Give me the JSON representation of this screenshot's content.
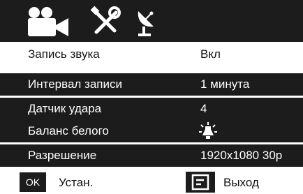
{
  "top_icons": [
    {
      "icon": "video-camera-icon"
    },
    {
      "icon": "tools-icon"
    },
    {
      "icon": "satellite-dish-icon"
    }
  ],
  "menu": {
    "items": [
      {
        "label": "Запись звука",
        "value": "Вкл",
        "selected": true
      },
      {
        "label": "Интервал записи",
        "value": "1 минута",
        "selected": false
      },
      {
        "label": "Датчик удара",
        "value": "4",
        "selected": false
      },
      {
        "label": "Баланс белого",
        "value_icon": "lightbulb-icon",
        "selected": false
      },
      {
        "label": "Разрешение",
        "value": "1920x1080 30p",
        "selected": false
      }
    ]
  },
  "bottom": {
    "ok_label": "OK",
    "set_label": "Устан.",
    "menu_icon": "menu-box-icon",
    "exit_label": "Выход"
  },
  "colors": {
    "background_dark": "#1c1c1c",
    "selection": "#ffffff",
    "text_light": "#ffffff",
    "text_dark": "#111111"
  }
}
